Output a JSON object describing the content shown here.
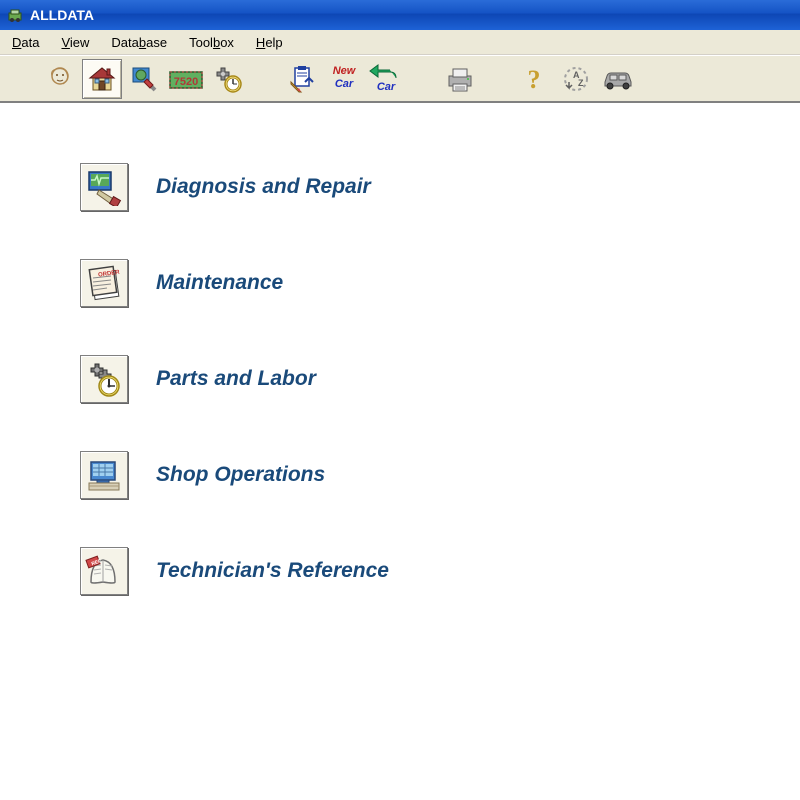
{
  "window": {
    "title": "ALLDATA"
  },
  "menu": {
    "items": [
      {
        "label": "Data",
        "hotkey_index": 0
      },
      {
        "label": "View",
        "hotkey_index": 0
      },
      {
        "label": "Database",
        "hotkey_index": 4
      },
      {
        "label": "Toolbox",
        "hotkey_index": 4
      },
      {
        "label": "Help",
        "hotkey_index": 0
      }
    ]
  },
  "toolbar": {
    "icons": [
      {
        "name": "head-icon"
      },
      {
        "name": "home-icon",
        "active": true
      },
      {
        "name": "globe-tool-icon"
      },
      {
        "name": "code-7520-icon",
        "text": "7520"
      },
      {
        "name": "clock-gears-icon"
      },
      {
        "gap": true
      },
      {
        "name": "clipboard-tool-icon"
      },
      {
        "name": "new-car-icon",
        "text": "New Car"
      },
      {
        "name": "back-car-icon",
        "text": "Car"
      },
      {
        "gap": true
      },
      {
        "name": "printer-icon"
      },
      {
        "gap": true
      },
      {
        "name": "help-icon"
      },
      {
        "name": "sort-az-icon"
      },
      {
        "name": "car-icon"
      }
    ]
  },
  "categories": {
    "items": [
      {
        "label": "Diagnosis and Repair",
        "icon": "diagnosis-icon"
      },
      {
        "label": "Maintenance",
        "icon": "maintenance-icon"
      },
      {
        "label": "Parts and Labor",
        "icon": "parts-labor-icon"
      },
      {
        "label": "Shop Operations",
        "icon": "shop-operations-icon"
      },
      {
        "label": "Technician's Reference",
        "icon": "tech-reference-icon"
      }
    ]
  }
}
